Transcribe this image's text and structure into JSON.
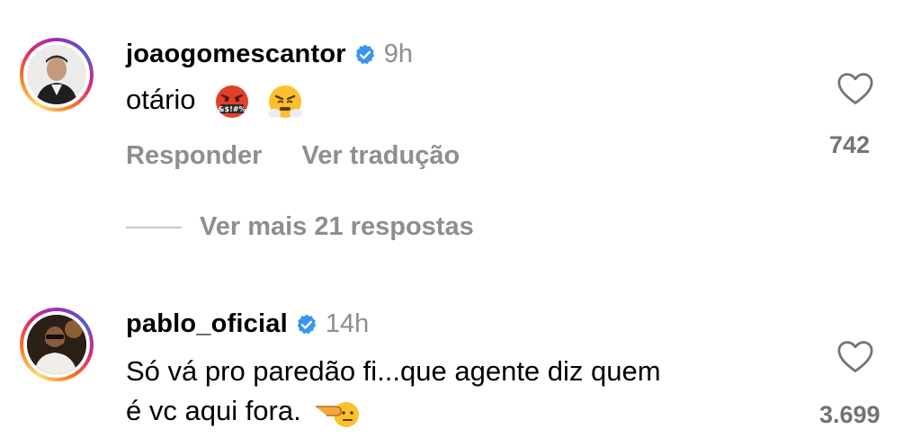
{
  "comments": [
    {
      "username": "joaogomescantor",
      "time": "9h",
      "text": "otário",
      "emojis": [
        "face-with-symbols-on-mouth",
        "face-with-steam-from-nose"
      ],
      "actions": {
        "reply": "Responder",
        "translate": "Ver tradução"
      },
      "likes": "742"
    },
    {
      "username": "pablo_oficial",
      "time": "14h",
      "text_line1": "Só vá pro paredão fi...que agente diz quem",
      "text_line2": "é vc aqui fora.",
      "emojis": [
        "hand-pointing-left"
      ],
      "likes": "3.699"
    }
  ],
  "more_replies": "Ver mais 21 respostas",
  "colors": {
    "verified": "#3797f0",
    "muted_text": "#8e8e8e",
    "like_count": "#737373",
    "divider": "#c7c7c7"
  }
}
